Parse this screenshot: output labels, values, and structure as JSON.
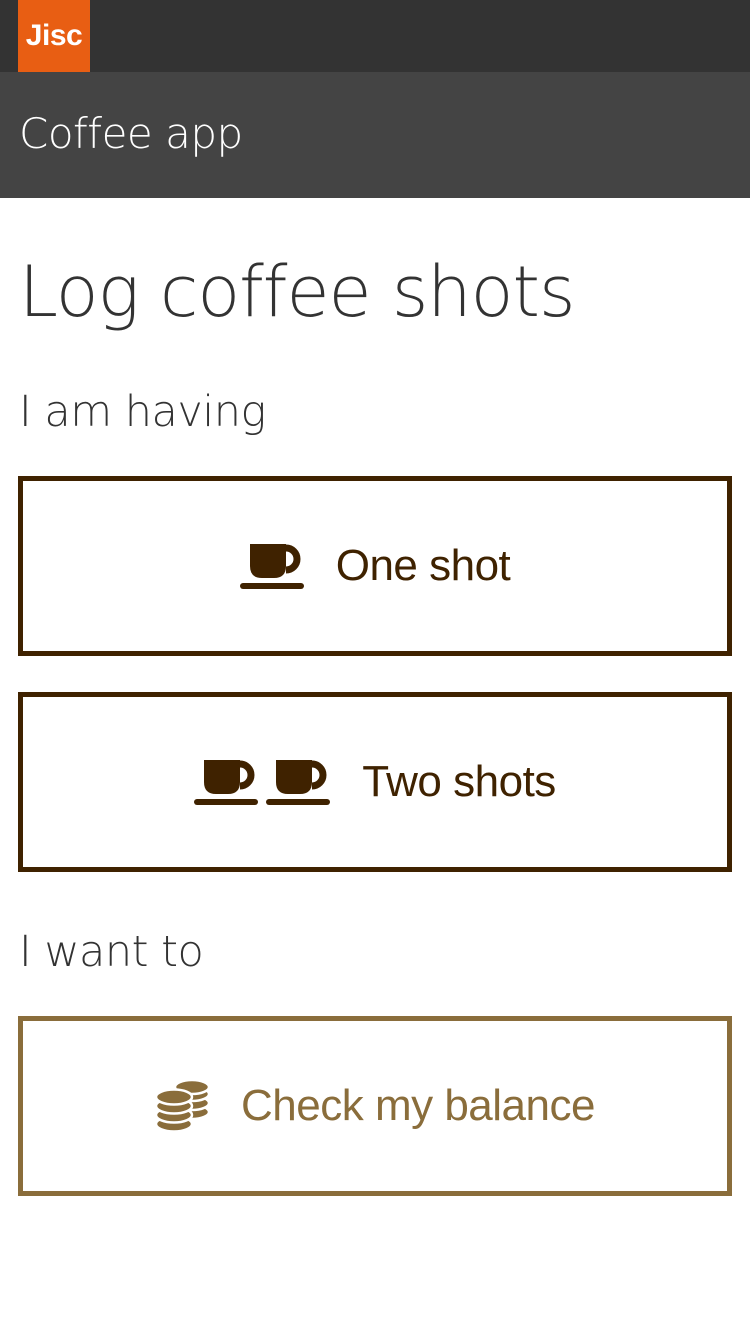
{
  "header": {
    "logo_text": "Jisc",
    "app_title": "Coffee app"
  },
  "page": {
    "title": "Log coffee shots"
  },
  "sections": {
    "having_label": "I am having",
    "want_label": "I want to"
  },
  "buttons": {
    "one_shot": {
      "label": "One shot",
      "icon": "coffee-cup-icon"
    },
    "two_shots": {
      "label": "Two shots",
      "icon": "coffee-cup-icon"
    },
    "check_balance": {
      "label": "Check my balance",
      "icon": "coins-icon"
    }
  },
  "colors": {
    "topbar": "#333333",
    "appbar": "#444444",
    "brand_orange": "#e85e13",
    "coffee_brown": "#3f2200",
    "balance_gold": "#8a6d3b"
  }
}
